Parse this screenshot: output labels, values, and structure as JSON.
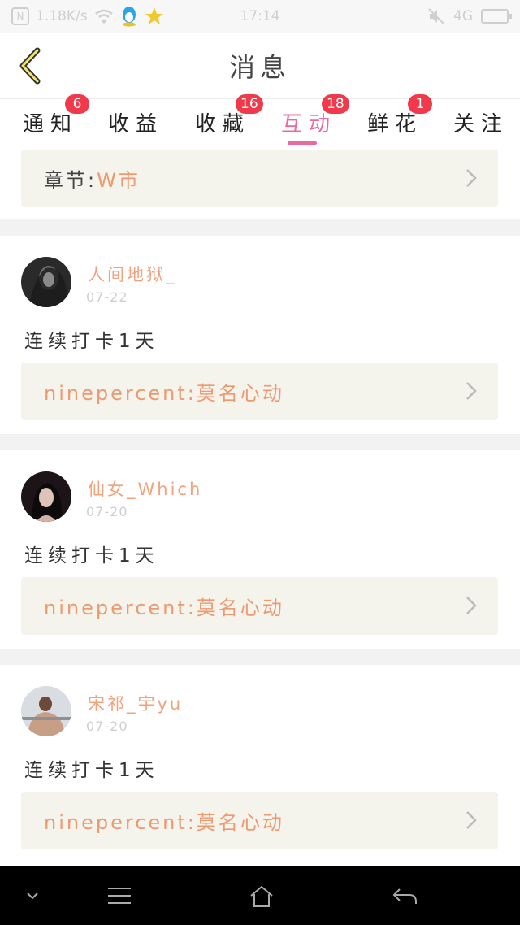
{
  "status_bar": {
    "network_speed": "1.18K/s",
    "time": "17:14",
    "signal": "4G",
    "carrier_icon_text": "N"
  },
  "header": {
    "title": "消息"
  },
  "tabs": [
    {
      "label": "通知",
      "badge": "6"
    },
    {
      "label": "收益",
      "badge": ""
    },
    {
      "label": "收藏",
      "badge": "16"
    },
    {
      "label": "互动",
      "badge": "18",
      "active": true
    },
    {
      "label": "鲜花",
      "badge": "1"
    },
    {
      "label": "关注",
      "badge": ""
    }
  ],
  "top_ref": {
    "label": "章节:",
    "value": "W市"
  },
  "items": [
    {
      "username": "人间地狱_",
      "date": "07-22",
      "message": "连续打卡1天",
      "ref": "ninepercent:莫名心动"
    },
    {
      "username": "仙女_Which",
      "date": "07-20",
      "message": "连续打卡1天",
      "ref": "ninepercent:莫名心动"
    },
    {
      "username": "宋祁_宇yu",
      "date": "07-20",
      "message": "连续打卡1天",
      "ref": "ninepercent:莫名心动"
    }
  ],
  "colors": {
    "accent": "#e86aa0",
    "badge": "#f0394a",
    "username": "#f2a27c",
    "ref_text": "#ee9a70",
    "ref_bg": "#f4f3ec"
  },
  "icons": {
    "back": "chevron-left-icon",
    "ref_arrow": "chevron-right-icon",
    "nav": [
      "chevron-down-icon",
      "menu-icon",
      "home-icon",
      "back-arrow-icon"
    ]
  }
}
